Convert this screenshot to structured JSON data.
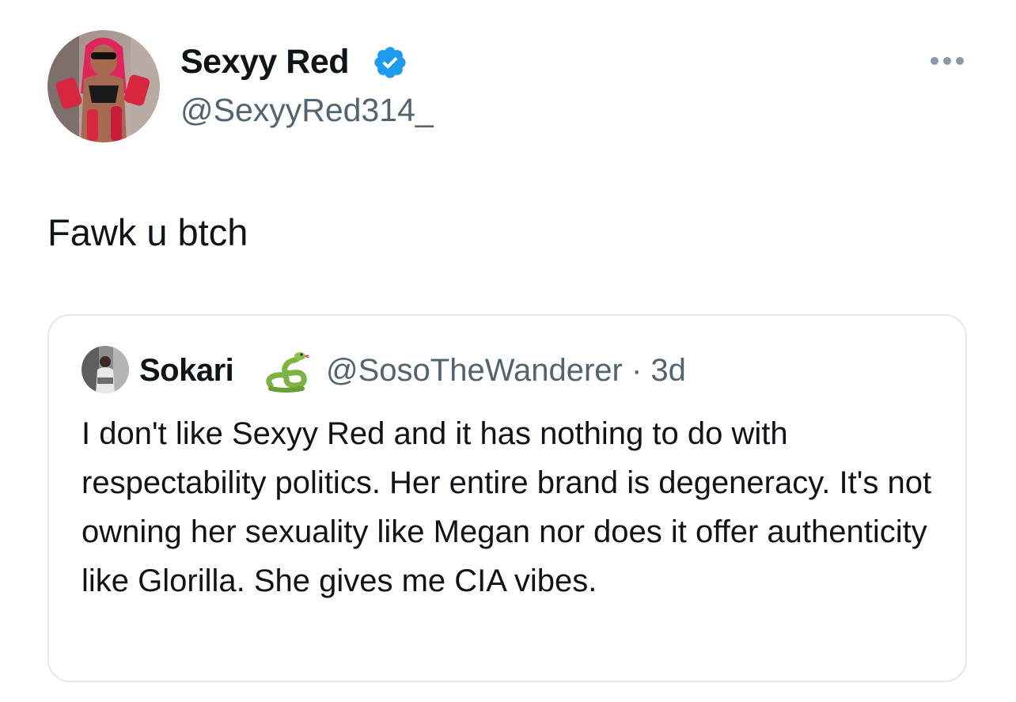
{
  "tweet": {
    "author": {
      "display_name": "Sexyy Red",
      "handle": "@SexyyRed314_",
      "verified": true,
      "avatar_icon": "profile-photo"
    },
    "more_icon": "more-horizontal-icon",
    "text": "Fawk u btch"
  },
  "quoted_tweet": {
    "author": {
      "display_name": "Sokari",
      "emoji": "snake",
      "handle": "@SosoTheWanderer",
      "separator": "·",
      "time": "3d"
    },
    "text": "I don't like Sexyy Red and it has nothing to do with respectability politics. Her entire brand is degeneracy. It's not owning her sexuality like Megan nor does it offer authenticity like Glorilla. She gives me CIA vibes."
  },
  "colors": {
    "text_primary": "#0f1419",
    "text_secondary": "#536471",
    "verified_blue": "#1d9bf0",
    "border": "#e1e8ed"
  }
}
